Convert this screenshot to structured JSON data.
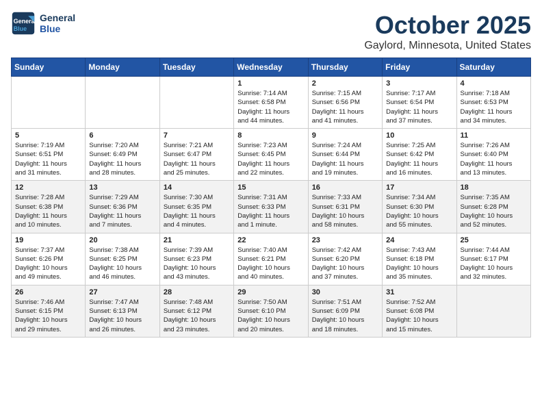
{
  "header": {
    "logo_line1": "General",
    "logo_line2": "Blue",
    "month": "October 2025",
    "location": "Gaylord, Minnesota, United States"
  },
  "weekdays": [
    "Sunday",
    "Monday",
    "Tuesday",
    "Wednesday",
    "Thursday",
    "Friday",
    "Saturday"
  ],
  "weeks": [
    [
      {
        "day": "",
        "info": ""
      },
      {
        "day": "",
        "info": ""
      },
      {
        "day": "",
        "info": ""
      },
      {
        "day": "1",
        "info": "Sunrise: 7:14 AM\nSunset: 6:58 PM\nDaylight: 11 hours\nand 44 minutes."
      },
      {
        "day": "2",
        "info": "Sunrise: 7:15 AM\nSunset: 6:56 PM\nDaylight: 11 hours\nand 41 minutes."
      },
      {
        "day": "3",
        "info": "Sunrise: 7:17 AM\nSunset: 6:54 PM\nDaylight: 11 hours\nand 37 minutes."
      },
      {
        "day": "4",
        "info": "Sunrise: 7:18 AM\nSunset: 6:53 PM\nDaylight: 11 hours\nand 34 minutes."
      }
    ],
    [
      {
        "day": "5",
        "info": "Sunrise: 7:19 AM\nSunset: 6:51 PM\nDaylight: 11 hours\nand 31 minutes."
      },
      {
        "day": "6",
        "info": "Sunrise: 7:20 AM\nSunset: 6:49 PM\nDaylight: 11 hours\nand 28 minutes."
      },
      {
        "day": "7",
        "info": "Sunrise: 7:21 AM\nSunset: 6:47 PM\nDaylight: 11 hours\nand 25 minutes."
      },
      {
        "day": "8",
        "info": "Sunrise: 7:23 AM\nSunset: 6:45 PM\nDaylight: 11 hours\nand 22 minutes."
      },
      {
        "day": "9",
        "info": "Sunrise: 7:24 AM\nSunset: 6:44 PM\nDaylight: 11 hours\nand 19 minutes."
      },
      {
        "day": "10",
        "info": "Sunrise: 7:25 AM\nSunset: 6:42 PM\nDaylight: 11 hours\nand 16 minutes."
      },
      {
        "day": "11",
        "info": "Sunrise: 7:26 AM\nSunset: 6:40 PM\nDaylight: 11 hours\nand 13 minutes."
      }
    ],
    [
      {
        "day": "12",
        "info": "Sunrise: 7:28 AM\nSunset: 6:38 PM\nDaylight: 11 hours\nand 10 minutes."
      },
      {
        "day": "13",
        "info": "Sunrise: 7:29 AM\nSunset: 6:36 PM\nDaylight: 11 hours\nand 7 minutes."
      },
      {
        "day": "14",
        "info": "Sunrise: 7:30 AM\nSunset: 6:35 PM\nDaylight: 11 hours\nand 4 minutes."
      },
      {
        "day": "15",
        "info": "Sunrise: 7:31 AM\nSunset: 6:33 PM\nDaylight: 11 hours\nand 1 minute."
      },
      {
        "day": "16",
        "info": "Sunrise: 7:33 AM\nSunset: 6:31 PM\nDaylight: 10 hours\nand 58 minutes."
      },
      {
        "day": "17",
        "info": "Sunrise: 7:34 AM\nSunset: 6:30 PM\nDaylight: 10 hours\nand 55 minutes."
      },
      {
        "day": "18",
        "info": "Sunrise: 7:35 AM\nSunset: 6:28 PM\nDaylight: 10 hours\nand 52 minutes."
      }
    ],
    [
      {
        "day": "19",
        "info": "Sunrise: 7:37 AM\nSunset: 6:26 PM\nDaylight: 10 hours\nand 49 minutes."
      },
      {
        "day": "20",
        "info": "Sunrise: 7:38 AM\nSunset: 6:25 PM\nDaylight: 10 hours\nand 46 minutes."
      },
      {
        "day": "21",
        "info": "Sunrise: 7:39 AM\nSunset: 6:23 PM\nDaylight: 10 hours\nand 43 minutes."
      },
      {
        "day": "22",
        "info": "Sunrise: 7:40 AM\nSunset: 6:21 PM\nDaylight: 10 hours\nand 40 minutes."
      },
      {
        "day": "23",
        "info": "Sunrise: 7:42 AM\nSunset: 6:20 PM\nDaylight: 10 hours\nand 37 minutes."
      },
      {
        "day": "24",
        "info": "Sunrise: 7:43 AM\nSunset: 6:18 PM\nDaylight: 10 hours\nand 35 minutes."
      },
      {
        "day": "25",
        "info": "Sunrise: 7:44 AM\nSunset: 6:17 PM\nDaylight: 10 hours\nand 32 minutes."
      }
    ],
    [
      {
        "day": "26",
        "info": "Sunrise: 7:46 AM\nSunset: 6:15 PM\nDaylight: 10 hours\nand 29 minutes."
      },
      {
        "day": "27",
        "info": "Sunrise: 7:47 AM\nSunset: 6:13 PM\nDaylight: 10 hours\nand 26 minutes."
      },
      {
        "day": "28",
        "info": "Sunrise: 7:48 AM\nSunset: 6:12 PM\nDaylight: 10 hours\nand 23 minutes."
      },
      {
        "day": "29",
        "info": "Sunrise: 7:50 AM\nSunset: 6:10 PM\nDaylight: 10 hours\nand 20 minutes."
      },
      {
        "day": "30",
        "info": "Sunrise: 7:51 AM\nSunset: 6:09 PM\nDaylight: 10 hours\nand 18 minutes."
      },
      {
        "day": "31",
        "info": "Sunrise: 7:52 AM\nSunset: 6:08 PM\nDaylight: 10 hours\nand 15 minutes."
      },
      {
        "day": "",
        "info": ""
      }
    ]
  ]
}
